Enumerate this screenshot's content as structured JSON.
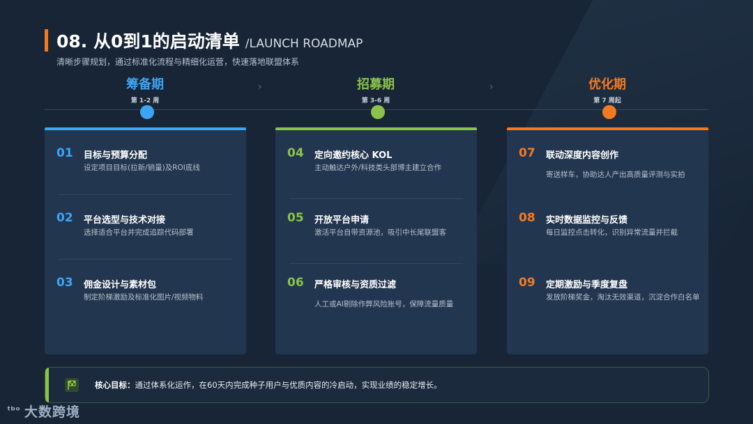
{
  "header": {
    "title": "08. 从0到1的启动清单",
    "title_en": "/LAUNCH ROADMAP",
    "subtitle": "清晰步骤规划，通过标准化流程与精细化运营，快速落地联盟体系"
  },
  "colors": {
    "blue": "#3da5f5",
    "green": "#8bc34a",
    "orange": "#f47a20"
  },
  "phases": [
    {
      "name": "筹备期",
      "week": "第 1-2 周"
    },
    {
      "name": "招募期",
      "week": "第 3-6 周"
    },
    {
      "name": "优化期",
      "week": "第 7 周起"
    }
  ],
  "cards": [
    {
      "items": [
        {
          "num": "01",
          "title": "目标与预算分配",
          "desc": "设定项目目标(拉新/销量)及ROI底线"
        },
        {
          "num": "02",
          "title": "平台选型与技术对接",
          "desc": "选择适合平台并完成追踪代码部署"
        },
        {
          "num": "03",
          "title": "佣金设计与素材包",
          "desc": "制定阶梯激励及标准化图片/视频物料"
        }
      ]
    },
    {
      "items": [
        {
          "num": "04",
          "title": "定向邀约核心 KOL",
          "desc": "主动触达户外/科技类头部博主建立合作"
        },
        {
          "num": "05",
          "title": "开放平台申请",
          "desc": "激活平台自带资源池，吸引中长尾联盟客"
        },
        {
          "num": "06",
          "title": "严格审核与资质过滤",
          "desc": "人工或AI剔除作弊风险账号，保障流量质量"
        }
      ]
    },
    {
      "items": [
        {
          "num": "07",
          "title": "联动深度内容创作",
          "desc": "寄送样车，协助达人产出高质量评测与实拍"
        },
        {
          "num": "08",
          "title": "实时数据监控与反馈",
          "desc": "每日监控点击转化，识别异常流量并拦截"
        },
        {
          "num": "09",
          "title": "定期激励与季度复盘",
          "desc": "发放阶梯奖金，淘汰无效渠道，沉淀合作白名单"
        }
      ]
    }
  ],
  "goal": {
    "label": "核心目标：",
    "text": "通过体系化运作，在60天内完成种子用户与优质内容的冷启动，实现业绩的稳定增长。",
    "icon": "flag-icon"
  },
  "logo": {
    "mark": "ᵗᵇᵒ",
    "text": "大数跨境"
  }
}
